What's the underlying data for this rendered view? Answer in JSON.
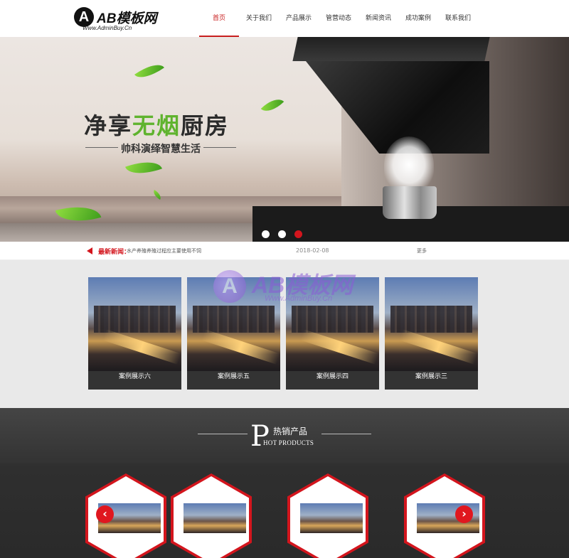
{
  "header": {
    "logo_mark": "A",
    "logo_title": "AB模板网",
    "logo_sub": "Www.AdminBuy.Cn",
    "nav": [
      {
        "label": "首页",
        "active": true
      },
      {
        "label": "关于我们"
      },
      {
        "label": "产品展示"
      },
      {
        "label": "管营动态"
      },
      {
        "label": "新闻资讯"
      },
      {
        "label": "成功案例"
      },
      {
        "label": "联系我们"
      }
    ]
  },
  "banner": {
    "headline_part1": "净享",
    "headline_accent": "无烟",
    "headline_part2": "厨房",
    "subline": "帅科演绎智慧生活",
    "slides": 3,
    "active_slide": 3
  },
  "news": {
    "label": "最新新闻：",
    "text": "水产养殖养殖过程应主要使用不饲",
    "date": "2018-02-08",
    "more": "更多"
  },
  "watermark": {
    "mark": "A",
    "title": "AB模板网",
    "sub": "Www.AdminBuy.Cn"
  },
  "cases": [
    {
      "label": "案例展示六"
    },
    {
      "label": "案例展示五"
    },
    {
      "label": "案例展示四"
    },
    {
      "label": "案例展示三"
    }
  ],
  "hot": {
    "letter": "P",
    "title": "热销产品",
    "subtitle": "HOT PRODUCTS",
    "prev": "‹",
    "next": "›"
  },
  "colors": {
    "accent": "#d3151d",
    "green": "#5fb32e",
    "dark": "#333333"
  }
}
